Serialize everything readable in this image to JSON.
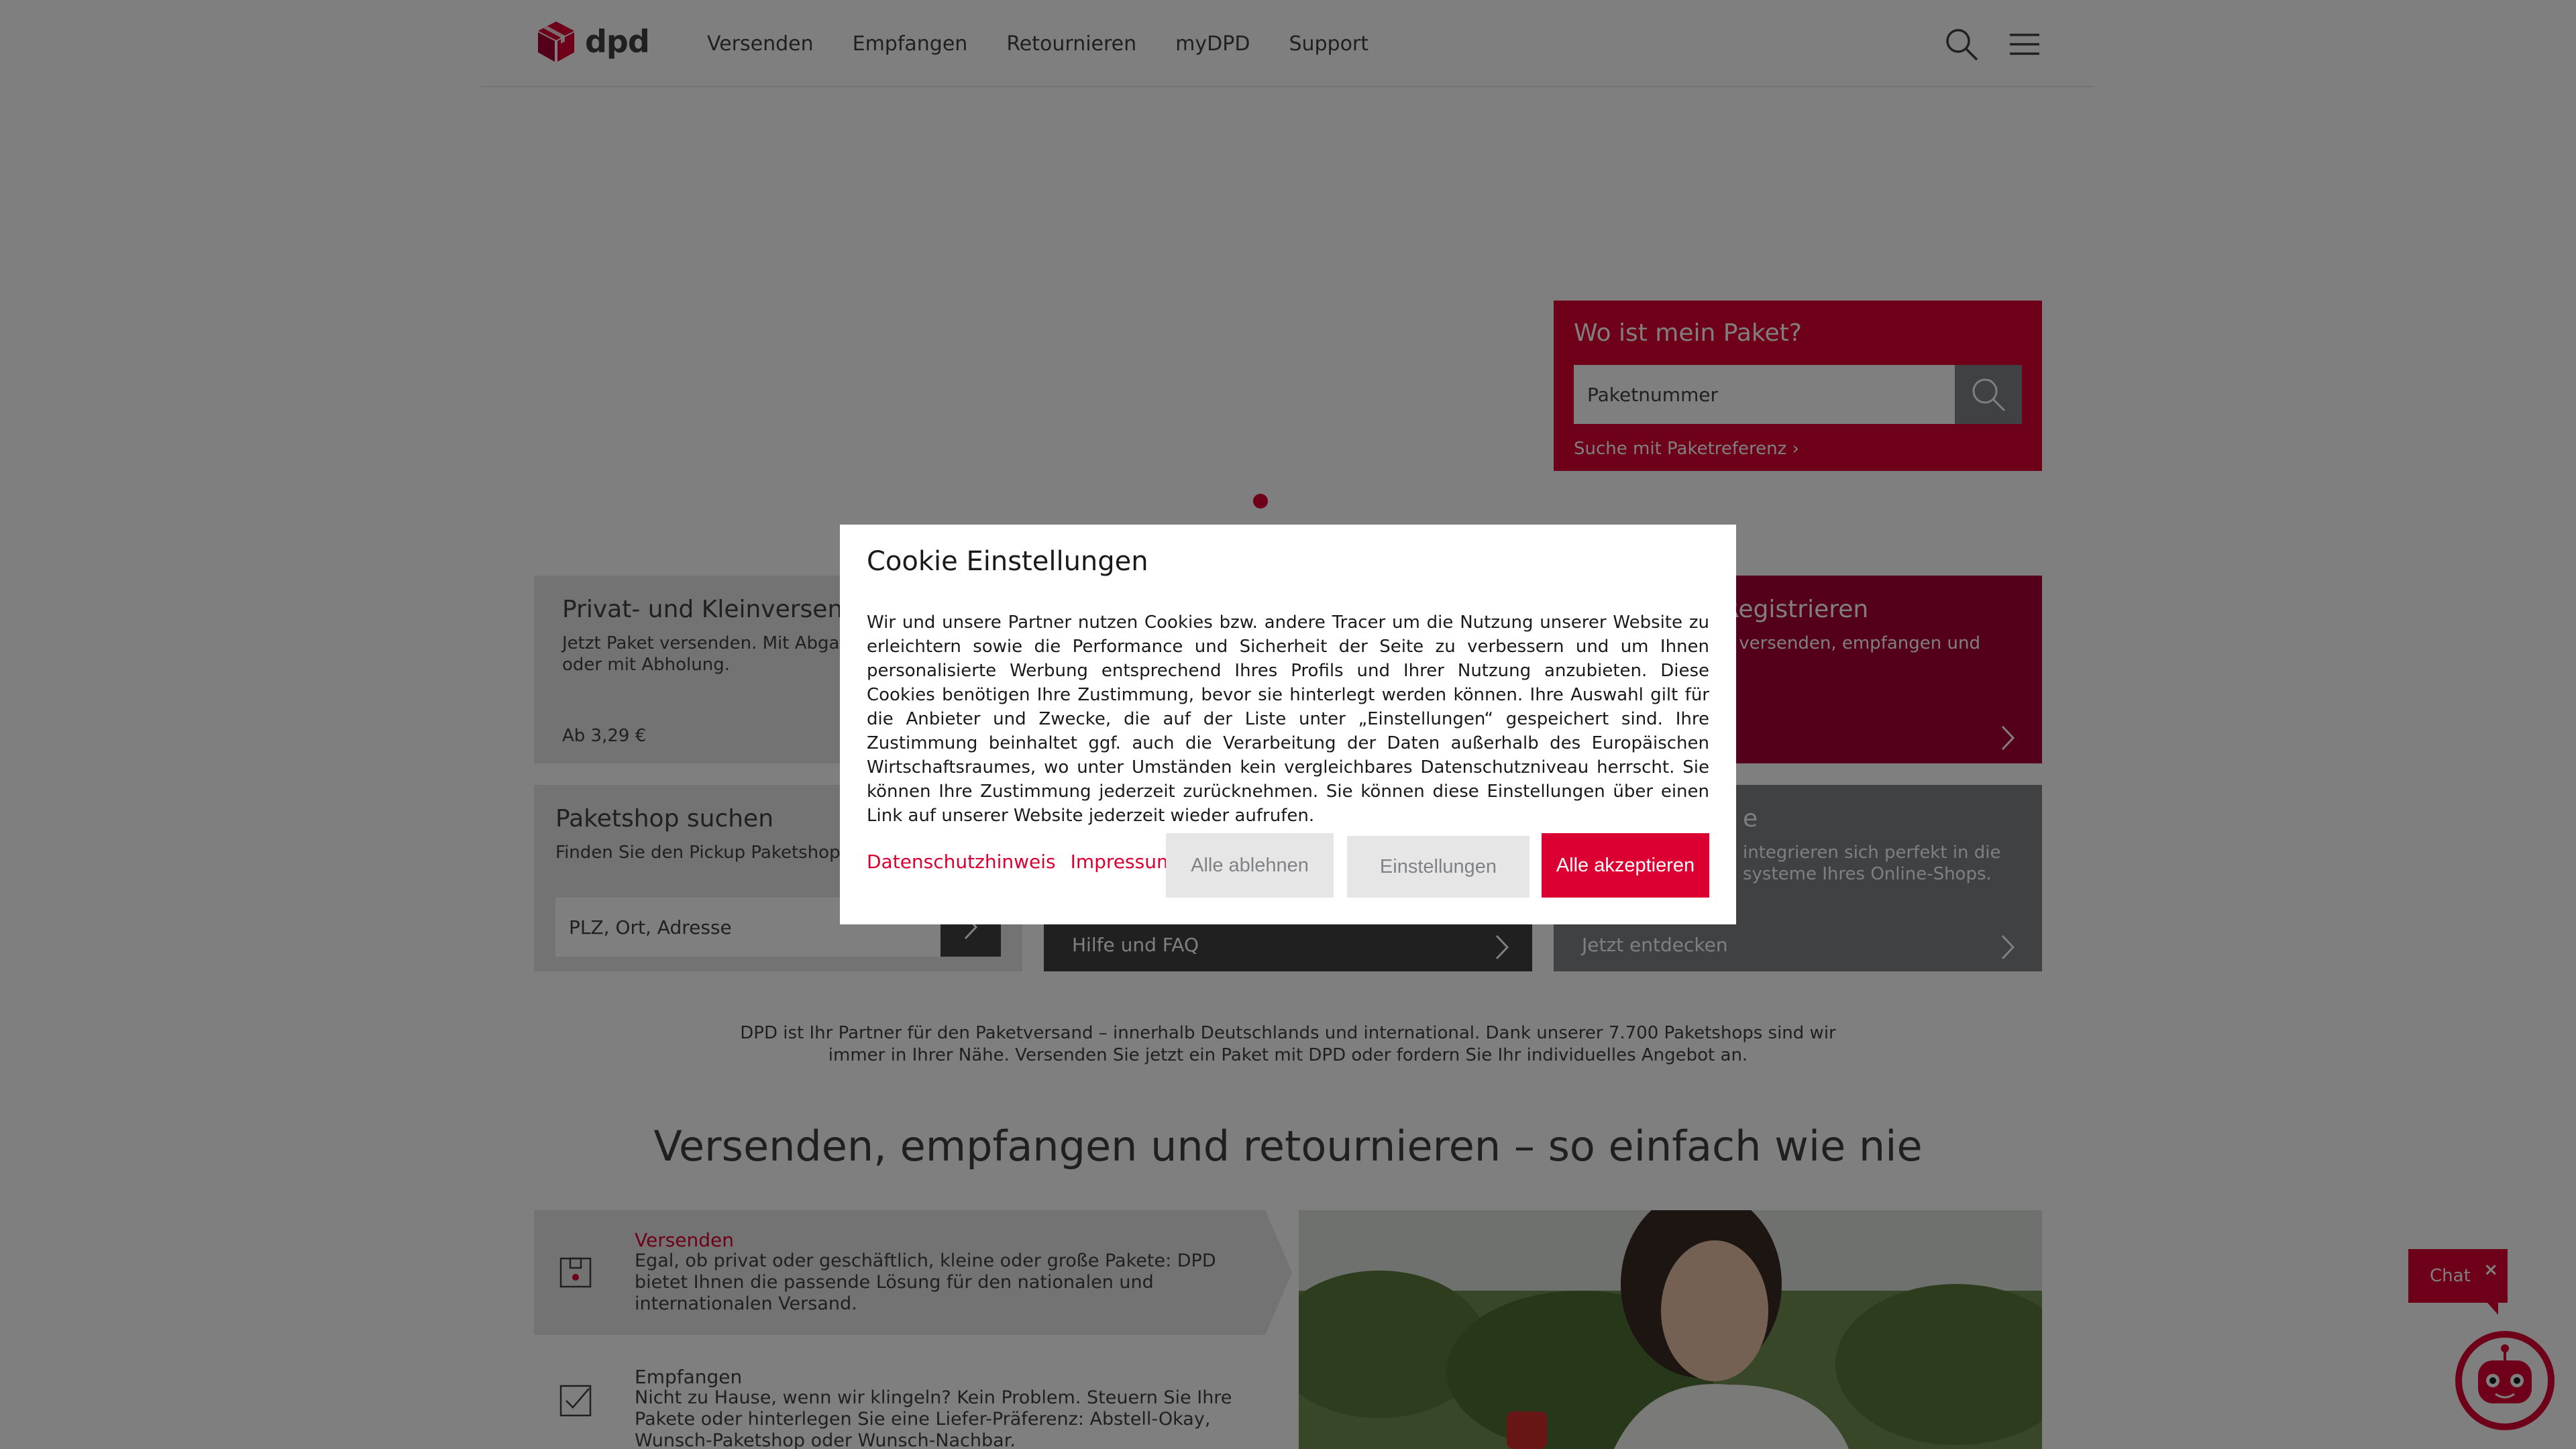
{
  "header": {
    "brand": "dpd",
    "nav": [
      "Versenden",
      "Empfangen",
      "Retournieren",
      "myDPD",
      "Support"
    ]
  },
  "tracking": {
    "title": "Wo ist mein Paket?",
    "placeholder": "Paketnummer",
    "reference_link": "Suche mit Paketreferenz"
  },
  "cards": {
    "private": {
      "title": "Privat- und Kleinversend",
      "text": "Jetzt Paket versenden. Mit Abga\noder mit Abholung.",
      "price": "Ab 3,29 €"
    },
    "register": {
      "title": "Registrieren",
      "text": "e versenden, empfangen und"
    },
    "shop": {
      "title": "Paketshop suchen",
      "text": "Finden Sie den Pickup Paketshop",
      "placeholder": "PLZ, Ort, Adresse"
    },
    "help": {
      "link": "Hilfe und FAQ"
    },
    "business": {
      "title": "e",
      "text": "integrieren sich perfekt in die\nsysteme Ihres Online-Shops.",
      "link": "Jetzt entdecken"
    }
  },
  "intro_text": "DPD ist Ihr Partner für den Paketversand – innerhalb Deutschlands und international. Dank unserer 7.700 Paketshops sind wir immer in Ihrer Nähe. Versenden Sie jetzt ein Paket mit DPD oder fordern Sie Ihr individuelles Angebot an.",
  "section_title": "Versenden, empfangen und retournieren – so einfach wie nie",
  "steps": [
    {
      "title": "Versenden",
      "text": "Egal, ob privat oder geschäftlich, kleine oder große Pakete: DPD bietet Ihnen die passende Lösung für den nationalen und internationalen Versand."
    },
    {
      "title": "Empfangen",
      "text": "Nicht zu Hause, wenn wir klingeln? Kein Problem. Steuern Sie Ihre Pakete oder hinterlegen Sie eine Liefer-Präferenz: Abstell-Okay, Wunsch-Paketshop oder Wunsch-Nachbar."
    }
  ],
  "chat": {
    "label": "Chat",
    "close": "×"
  },
  "cookie_modal": {
    "title": "Cookie Einstellungen",
    "text": "Wir und unsere Partner nutzen Cookies bzw. andere Tracer um die Nutzung unserer Website zu erleichtern sowie die Performance und Sicherheit der Seite zu verbessern und um Ihnen personalisierte Werbung entsprechend Ihres Profils und Ihrer Nutzung anzubieten. Diese Cookies benötigen Ihre Zustimmung, bevor sie hinterlegt werden können. Ihre Auswahl gilt für die Anbieter und Zwecke, die auf der Liste unter „Einstellungen“ gespeichert sind. Ihre Zustimmung beinhaltet ggf. auch die Verarbeitung der Daten außerhalb des Europäischen Wirtschaftsraumes, wo unter Umständen kein vergleichbares Datenschutzniveau herrscht. Sie können Ihre Zustimmung jederzeit zurücknehmen. Sie können diese Einstellungen über einen Link auf unserer Website jederzeit wieder aufrufen.",
    "link_privacy": "Datenschutzhinweis",
    "link_imprint": "Impressum",
    "btn_reject": "Alle ablehnen",
    "btn_settings": "Einstellungen",
    "btn_accept": "Alle akzeptieren"
  },
  "colors": {
    "brand_red": "#dc0032",
    "dark_red": "#a90034",
    "dark_grey": "#414141",
    "mid_grey": "#808285",
    "light_grey": "#e6e6e6"
  }
}
